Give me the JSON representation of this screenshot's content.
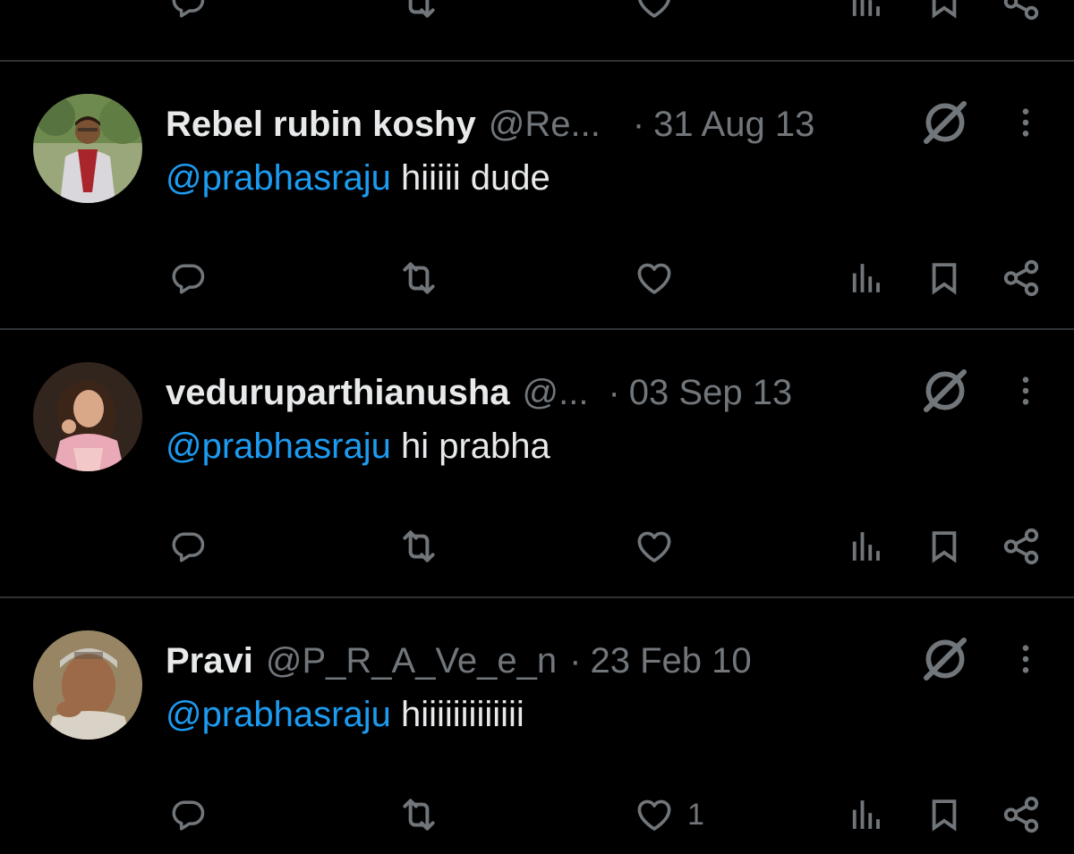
{
  "top_actions": {
    "reply_count": "",
    "retweet_count": "",
    "like_count": ""
  },
  "tweets": [
    {
      "display_name": "Rebel rubin koshy",
      "handle": "@Re...",
      "separator": "·",
      "date": "31 Aug 13",
      "mention": "@prabhasraju",
      "text": "hiiiii dude",
      "reply_count": "",
      "retweet_count": "",
      "like_count": "",
      "avatar_colors": {
        "bg": "#9aa77a",
        "shirt": "#d9d6dc",
        "scarf": "#a8262b",
        "skin": "#7a5133"
      }
    },
    {
      "display_name": "veduruparthianusha",
      "handle": "@...",
      "separator": "·",
      "date": "03 Sep 13",
      "mention": "@prabhasraju",
      "text": "hi prabha",
      "reply_count": "",
      "retweet_count": "",
      "like_count": "",
      "avatar_colors": {
        "bg": "#2a1f1a",
        "shirt": "#e9a9b6",
        "hair": "#3b2418",
        "skin": "#d9a889"
      }
    },
    {
      "display_name": "Pravi",
      "handle": "@P_R_A_Ve_e_n",
      "separator": "·",
      "date": "23 Feb 10",
      "mention": "@prabhasraju",
      "text": "hiiiiiiiiiiiii",
      "reply_count": "",
      "retweet_count": "",
      "like_count": "1",
      "avatar_colors": {
        "bg": "#8c7a5e",
        "shirt": "#d8d3c6",
        "cap": "#c9c6bd",
        "skin": "#9c6a48"
      }
    }
  ],
  "icons": {
    "reply": "reply-icon",
    "retweet": "retweet-icon",
    "like": "heart-icon",
    "views": "views-icon",
    "bookmark": "bookmark-icon",
    "share": "share-icon",
    "grok": "grok-icon",
    "more": "more-icon"
  },
  "colors": {
    "background": "#000000",
    "text": "#e7e9ea",
    "muted": "#71767b",
    "link": "#1d9bf0",
    "divider": "#2f3336"
  }
}
